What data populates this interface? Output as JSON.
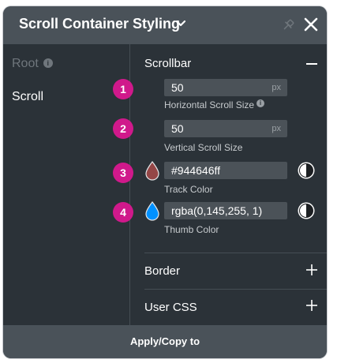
{
  "header": {
    "title": "Scroll Container Styling"
  },
  "sidebar": {
    "items": [
      {
        "label": "Root",
        "info": "i"
      },
      {
        "label": "Scroll"
      }
    ]
  },
  "scrollbar": {
    "title": "Scrollbar",
    "horizontal": {
      "badge": "1",
      "value": "50",
      "unit": "px",
      "label": "Horizontal Scroll Size",
      "info": "i"
    },
    "vertical": {
      "badge": "2",
      "value": "50",
      "unit": "px",
      "label": "Vertical Scroll Size"
    },
    "track": {
      "badge": "3",
      "value": "#944646ff",
      "label": "Track Color",
      "color": "#944646"
    },
    "thumb": {
      "badge": "4",
      "value": "rgba(0,145,255, 1)",
      "label": "Thumb Color",
      "color": "#0091ff"
    }
  },
  "sections": {
    "border": "Border",
    "user_css": "User CSS"
  },
  "footer": {
    "apply_label": "Apply/Copy to"
  },
  "colors": {
    "badge": "#d0198b",
    "panel": "#2b3238",
    "header": "#4a5259"
  }
}
